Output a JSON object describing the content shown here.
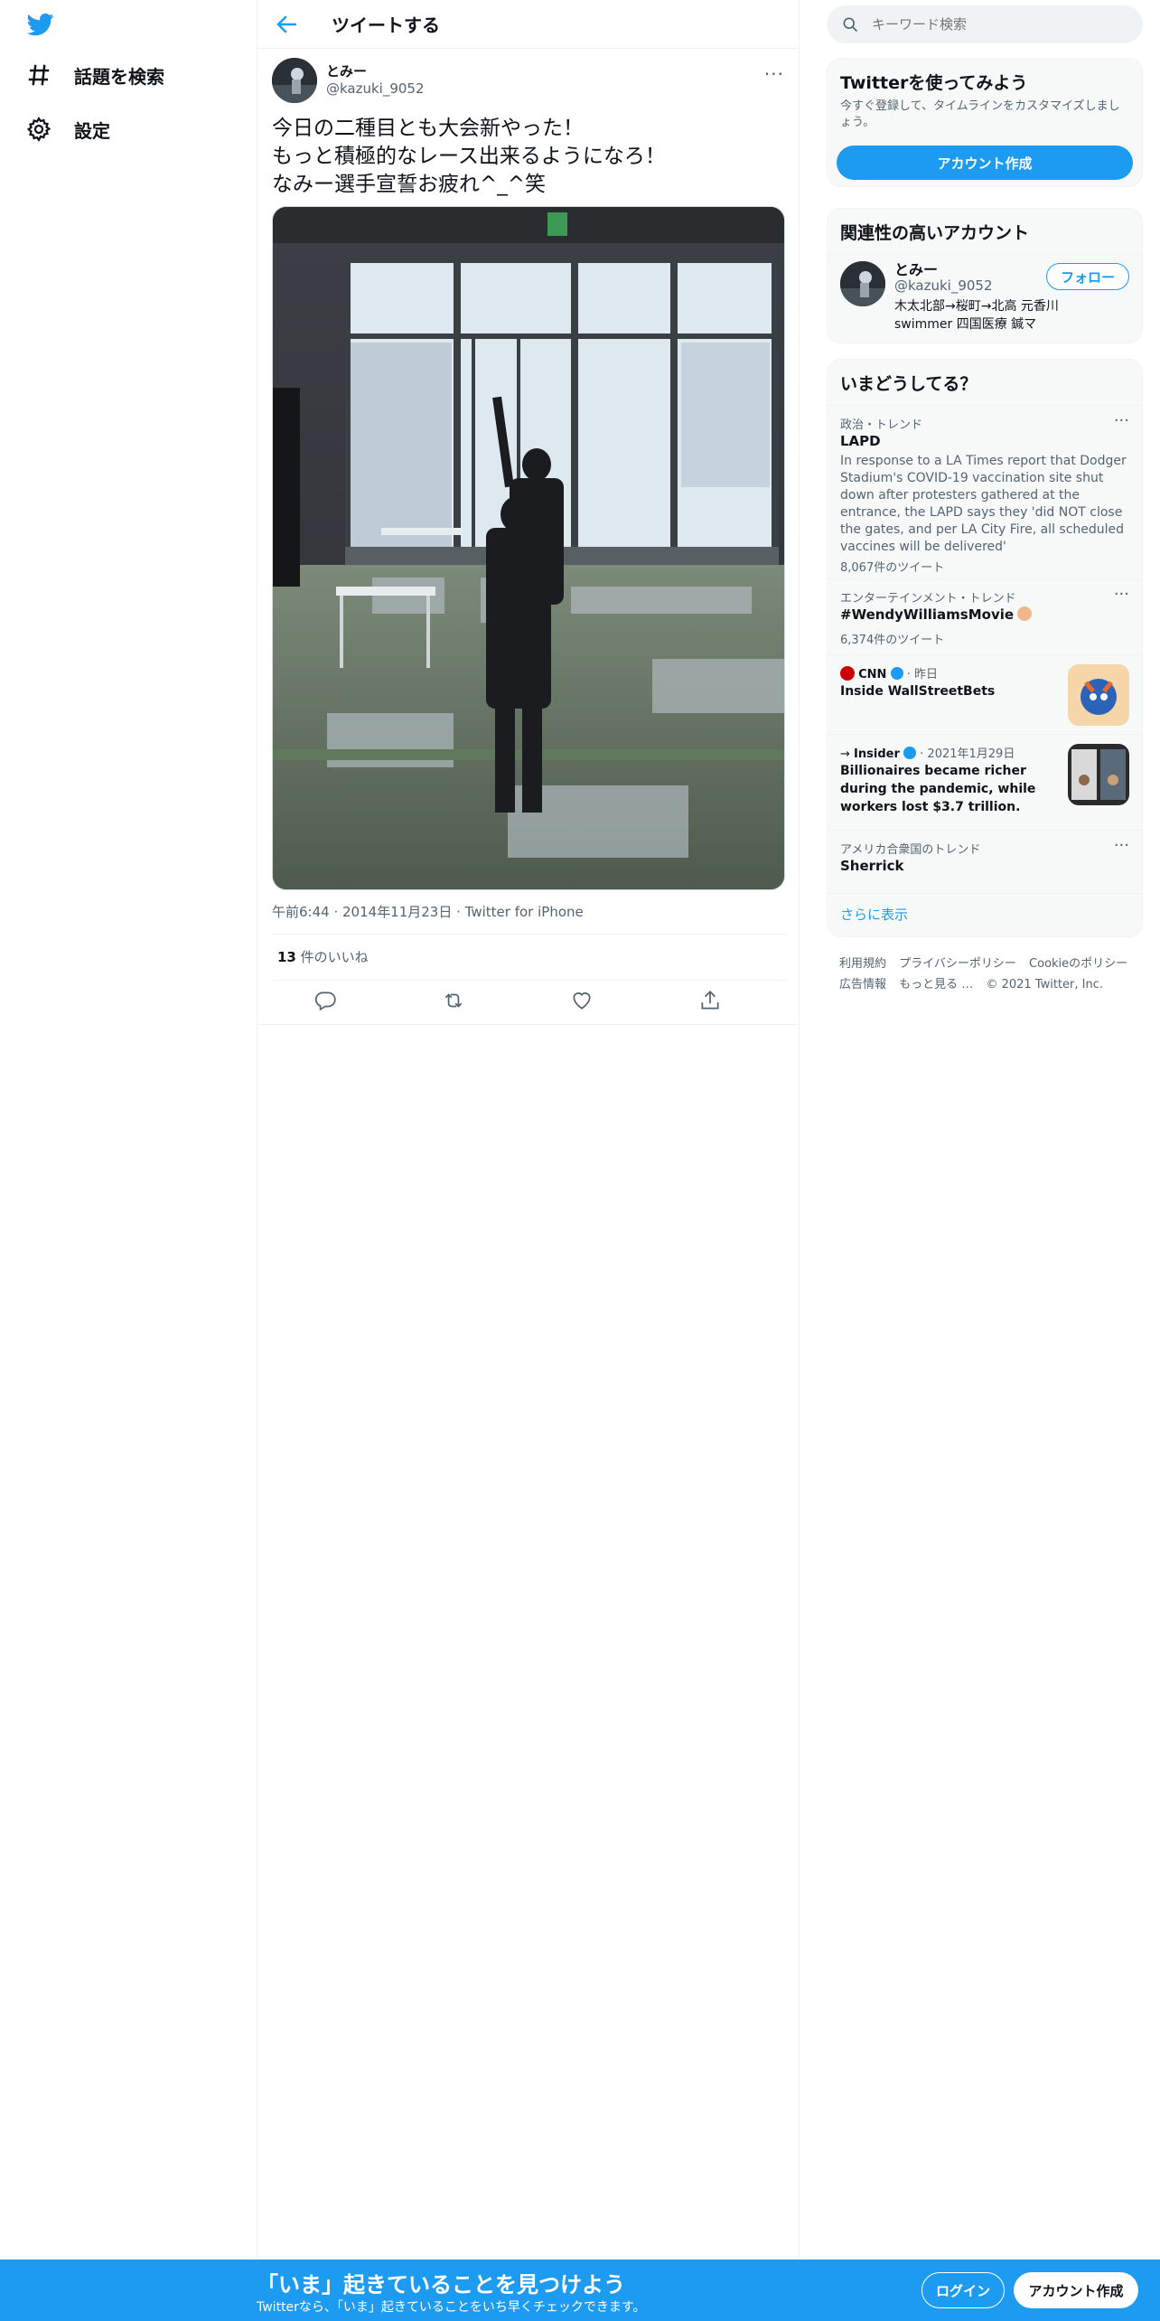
{
  "nav": {
    "items": [
      {
        "label": "話題を検索",
        "icon": "hashtag-icon"
      },
      {
        "label": "設定",
        "icon": "gear-icon"
      }
    ]
  },
  "header": {
    "title": "ツイートする"
  },
  "tweet": {
    "author_name": "とみー",
    "author_handle": "@kazuki_9052",
    "text_lines": [
      "今日の二種目とも大会新やった！",
      "もっと積極的なレース出来るようになろ！",
      "なみー選手宣誓お疲れ^_^笑"
    ],
    "time": "午前6:44",
    "date": "2014年11月23日",
    "source": "Twitter for iPhone",
    "likes_count": "13",
    "likes_label": " 件のいいね"
  },
  "search": {
    "placeholder": "キーワード検索"
  },
  "signup_card": {
    "title": "Twitterを使ってみよう",
    "description": "今すぐ登録して、タイムラインをカスタマイズしましょう。",
    "button": "アカウント作成"
  },
  "related": {
    "title": "関連性の高いアカウント",
    "name": "とみー",
    "handle": "@kazuki_9052",
    "bio": "木太北部→桜町→北高 元香川 swimmer 四国医療 鍼マ",
    "follow_button": "フォロー"
  },
  "trends": {
    "title": "いまどうしてる？",
    "items": [
      {
        "meta": "政治・トレンド",
        "title": "LAPD",
        "desc": "In response to a LA Times report that Dodger Stadium's COVID-19 vaccination site shut down after protesters gathered at the entrance, the LAPD says they 'did NOT close the gates, and per LA City Fire, all scheduled vaccines will be delivered'",
        "count": "8,067件のツイート"
      },
      {
        "meta": "エンターテインメント・トレンド",
        "title": "#WendyWilliamsMovie",
        "count": "6,374件のツイート"
      },
      {
        "source": "CNN",
        "when": "昨日",
        "title": "Inside WallStreetBets"
      },
      {
        "source": "Insider",
        "when": "2021年1月29日",
        "title": "Billionaires became richer during the pandemic, while workers lost $3.7 trillion."
      },
      {
        "meta": "アメリカ合衆国のトレンド",
        "title": "Sherrick"
      }
    ],
    "show_more": "さらに表示"
  },
  "footer": {
    "links": [
      "利用規約",
      "プライバシーポリシー",
      "Cookieのポリシー",
      "広告情報",
      "もっと見る …",
      "© 2021 Twitter, Inc."
    ]
  },
  "bottom_bar": {
    "title": "「いま」起きていることを見つけよう",
    "subtitle": "Twitterなら、「いま」起きていることをいち早くチェックできます。",
    "login": "ログイン",
    "signup": "アカウント作成"
  },
  "colors": {
    "accent": "#1d9bf0",
    "muted": "#536471"
  }
}
